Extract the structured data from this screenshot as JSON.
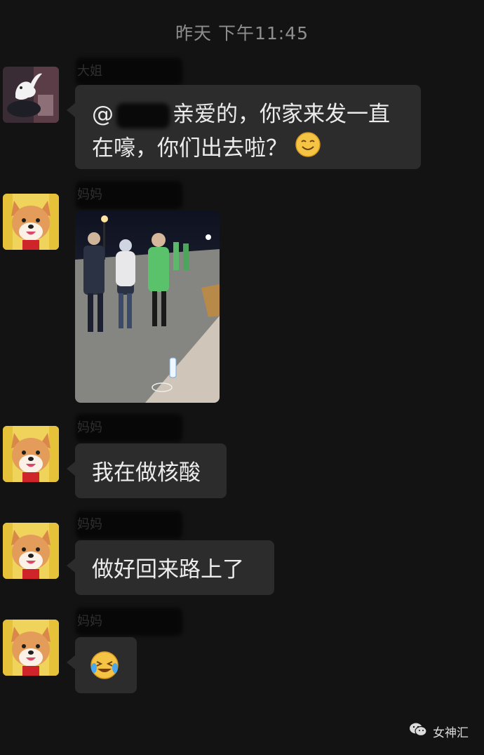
{
  "chat": {
    "timestamp": "昨天 下午11:45",
    "messages": [
      {
        "sender": "大姐",
        "text_prefix": "@",
        "text_main": "亲爱的，你家来发一直在嚎，你们出去啦？",
        "emoji_icon": "smile-icon"
      },
      {
        "sender": "妈妈",
        "type": "image",
        "image_desc_icon": "photo-icon"
      },
      {
        "sender": "妈妈",
        "text": "我在做核酸"
      },
      {
        "sender": "妈妈",
        "text": "做好回来路上了"
      },
      {
        "sender": "妈妈",
        "emoji_icon": "laughing-tears-icon"
      }
    ]
  },
  "watermark": {
    "label": "女神汇",
    "icon": "wechat-icon"
  },
  "colors": {
    "background": "#131313",
    "bubble": "#2c2c2c",
    "timestamp": "#8e8e8e"
  }
}
